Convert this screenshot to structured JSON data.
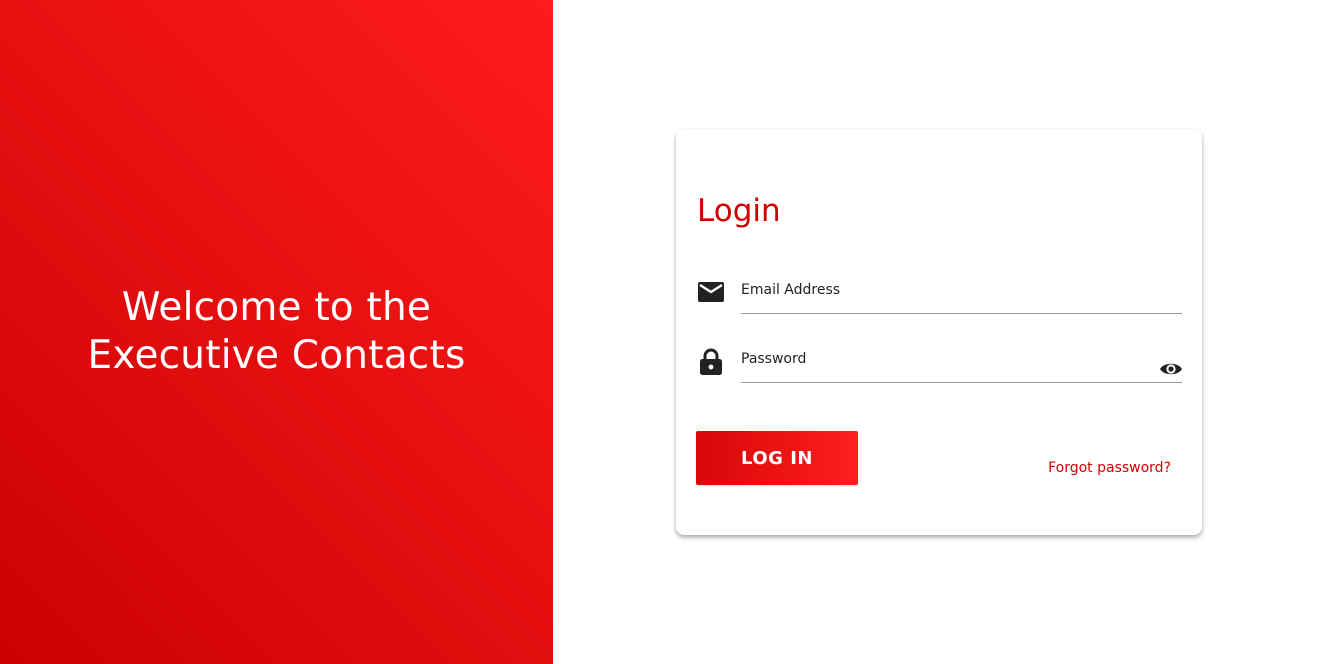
{
  "hero": {
    "title": "Welcome to the Executive Contacts"
  },
  "login": {
    "title": "Login",
    "email": {
      "label": "Email Address",
      "value": "",
      "icon": "mail-icon"
    },
    "password": {
      "label": "Password",
      "value": "",
      "icon": "lock-icon",
      "toggle_icon": "eye-icon"
    },
    "submit_label": "LOG IN",
    "forgot_label": "Forgot password?"
  },
  "colors": {
    "brand_red": "#d10000",
    "hero_gradient_start": "#cc0000",
    "hero_gradient_end": "#ff1b1c",
    "text_dark": "#222222",
    "underline": "#9b9b9b"
  }
}
